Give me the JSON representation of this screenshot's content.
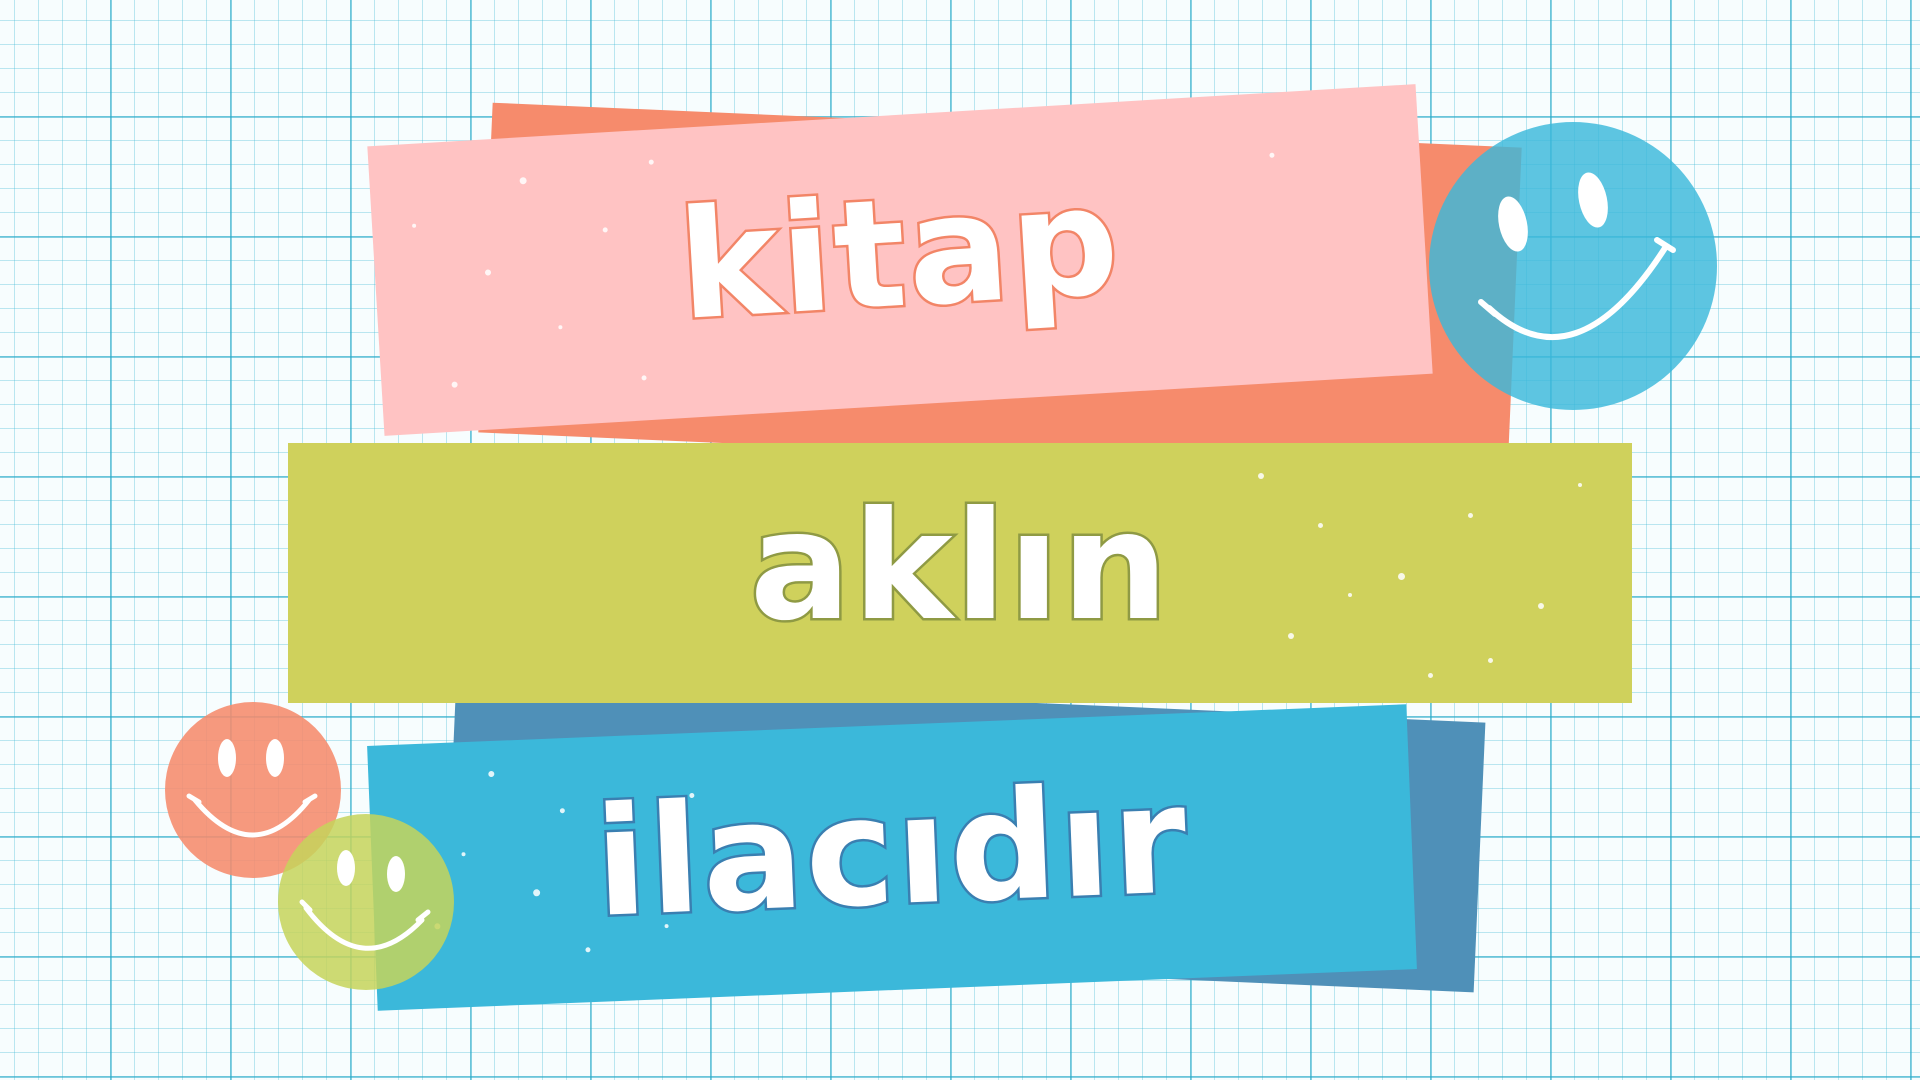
{
  "title_lines": {
    "line1": "kitap",
    "line2": "aklın",
    "line3": "ilacıdır"
  },
  "colors": {
    "pink_band": "#ffc3c3",
    "coral_band": "#f68b6c",
    "olive_band": "#cfd15c",
    "cyan_band": "#3bb8da",
    "steel_band": "#4f90b8",
    "pink_stroke": "#f28567",
    "olive_stroke": "#8f9a44",
    "cyan_stroke": "#3a7fb1",
    "smiley_blue": "#3bb8da",
    "smiley_coral": "#f68b6c",
    "smiley_green": "#c5d35a"
  },
  "icons": [
    "smiley-face-icon",
    "smiley-face-icon",
    "smiley-face-icon"
  ]
}
